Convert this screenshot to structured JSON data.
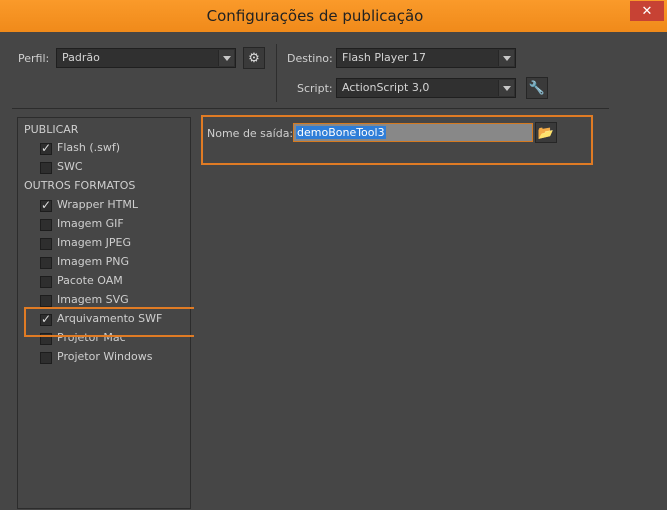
{
  "window": {
    "title": "Configurações de publicação",
    "close_glyph": "✕"
  },
  "profile": {
    "label": "Perfil:",
    "value": "Padrão"
  },
  "target": {
    "label": "Destino:",
    "value": "Flash Player 17"
  },
  "script": {
    "label": "Script:",
    "value": "ActionScript 3,0"
  },
  "publish": {
    "heading": "PUBLICAR",
    "items": [
      {
        "label": "Flash (.swf)",
        "checked": true
      },
      {
        "label": "SWC",
        "checked": false
      }
    ]
  },
  "other_formats": {
    "heading": "OUTROS FORMATOS",
    "items": [
      {
        "label": "Wrapper HTML",
        "checked": true
      },
      {
        "label": "Imagem GIF",
        "checked": false
      },
      {
        "label": "Imagem JPEG",
        "checked": false
      },
      {
        "label": "Imagem PNG",
        "checked": false
      },
      {
        "label": "Pacote OAM",
        "checked": false
      },
      {
        "label": "Imagem SVG",
        "checked": false
      },
      {
        "label": "Arquivamento SWF",
        "checked": true
      },
      {
        "label": "Projetor Mac",
        "checked": false
      },
      {
        "label": "Projetor Windows",
        "checked": false
      }
    ]
  },
  "output": {
    "label": "Nome de saída:",
    "value": "demoBoneTool3"
  },
  "colors": {
    "highlight": "#e07b24",
    "titlebar": "#f5921f"
  }
}
